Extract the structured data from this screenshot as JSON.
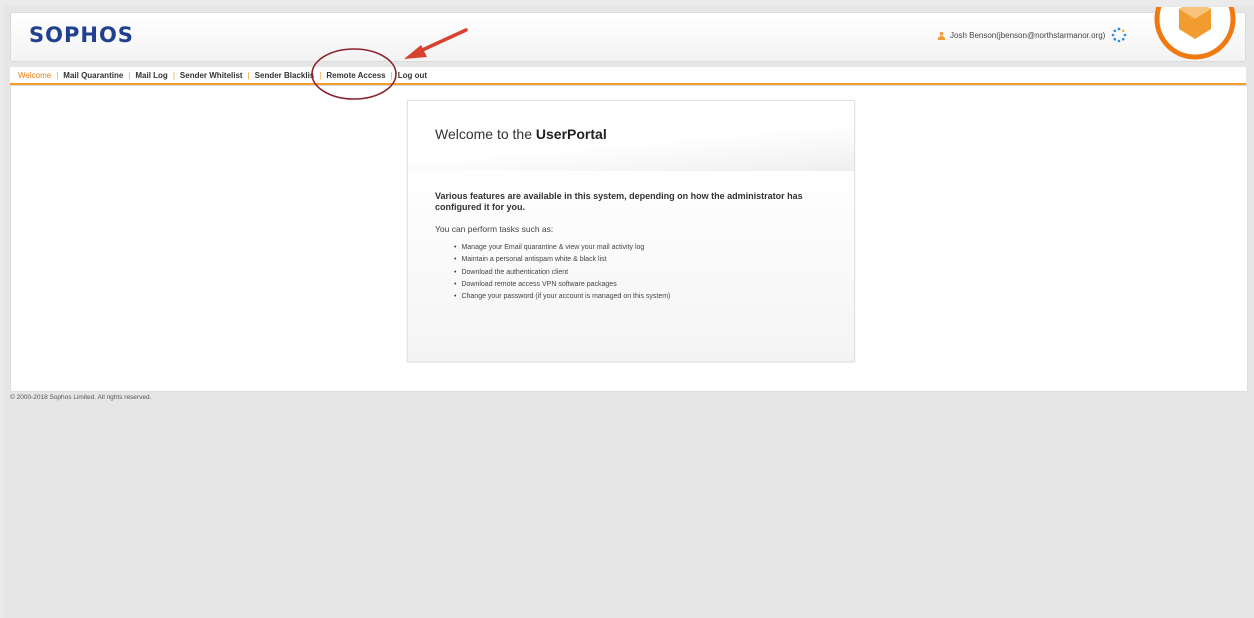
{
  "app": {
    "logo": "SOPHOS"
  },
  "user": {
    "display": "Josh Benson(jbenson@northstarmanor.org)"
  },
  "nav": {
    "items": [
      {
        "label": "Welcome",
        "active": true
      },
      {
        "label": "Mail Quarantine"
      },
      {
        "label": "Mail Log"
      },
      {
        "label": "Sender Whitelist"
      },
      {
        "label": "Sender Blacklis"
      },
      {
        "label": "Remote Access"
      },
      {
        "label": "Log out"
      }
    ]
  },
  "welcome": {
    "title_prefix": "Welcome to the ",
    "title_strong": "UserPortal",
    "intro": "Various features are available in this system, depending on how the administrator has configured it for you.",
    "tasks_label": "You can perform tasks such as:",
    "tasks": [
      "Manage your Email quarantine & view your mail activity log",
      "Maintain a personal antispam white & black list",
      "Download the authentication client",
      "Download remote access VPN software packages",
      "Change your password (if your account is managed on this system)"
    ]
  },
  "footer": {
    "copyright": "© 2000-2018 Sophos Limited. All rights reserved."
  },
  "colors": {
    "accent": "#f29b2e",
    "logo": "#1f3f8f",
    "annotation": "#d9412f",
    "circle": "#8b1e2b"
  },
  "icons": {
    "user": "user-icon",
    "spinner": "loading-spinner-icon",
    "avatar": "avatar-icon"
  }
}
